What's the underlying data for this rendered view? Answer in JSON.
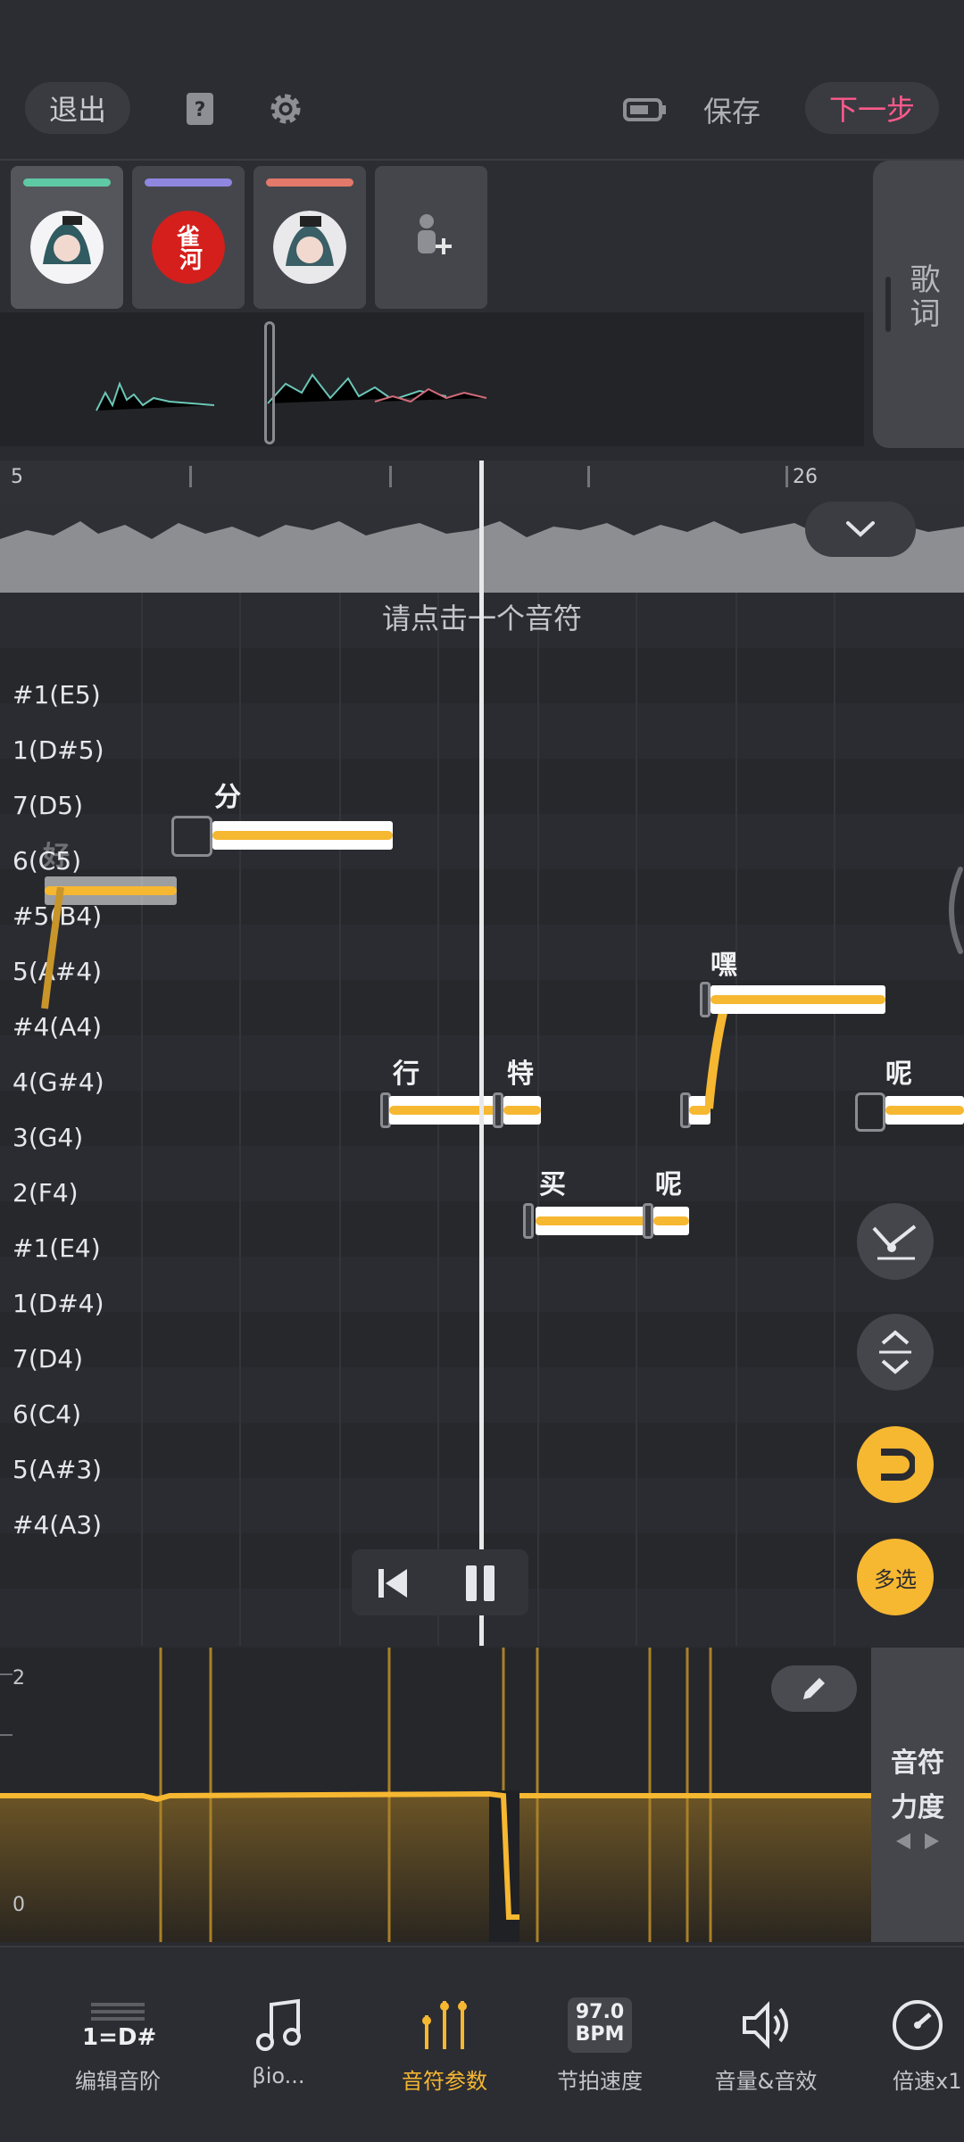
{
  "toolbar": {
    "exit_label": "退出",
    "save_label": "保存",
    "next_label": "下一步"
  },
  "tracks": [
    {
      "bar_color": "#5fc9a5",
      "avatar": "anime-girl-avatar"
    },
    {
      "bar_color": "#8f86e0",
      "avatar": "red-seal-avatar",
      "seal_text": "雀河"
    },
    {
      "bar_color": "#e2796b",
      "avatar": "anime-girl-avatar"
    }
  ],
  "lyrics_tab_label": "歌词",
  "ruler": {
    "left_number": "5",
    "right_number": "26"
  },
  "hint": "请点击一个音符",
  "pitches": [
    "#1(E5)",
    "1(D#5)",
    "7(D5)",
    "6(C5)",
    "#5(B4)",
    "5(A#4)",
    "#4(A4)",
    "4(G#4)",
    "3(G4)",
    "2(F4)",
    "#1(E4)",
    "1(D#4)",
    "7(D4)",
    "6(C4)",
    "5(A#3)",
    "#4(A3)"
  ],
  "lyrics": {
    "hao": "好",
    "fen": "分",
    "xing": "行",
    "te": "特",
    "mai": "买",
    "ne1": "呢",
    "hei": "嘿",
    "ne2": "呢"
  },
  "side_buttons": {
    "multi_select_label": "多选"
  },
  "param_lane": {
    "labels": [
      "2",
      "",
      "",
      "",
      "0"
    ],
    "tab_title_1": "音符",
    "tab_title_2": "力度"
  },
  "bottom_nav": [
    {
      "icon": "scale-icon",
      "icon_text": "1=D#",
      "label": "编辑音阶"
    },
    {
      "icon": "music-note-icon",
      "label": "βio..."
    },
    {
      "icon": "note-params-icon",
      "label": "音符参数",
      "active": true
    },
    {
      "icon": "bpm-icon",
      "icon_text_1": "97.0",
      "icon_text_2": "BPM",
      "label": "节拍速度"
    },
    {
      "icon": "volume-icon",
      "label": "音量&音效"
    },
    {
      "icon": "speed-icon",
      "label": "倍速x1"
    }
  ],
  "colors": {
    "accent": "#f6b731",
    "next": "#ff5a8c"
  }
}
